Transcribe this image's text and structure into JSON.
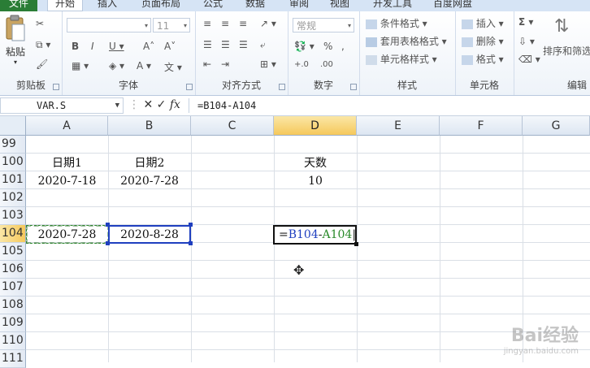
{
  "ribbon_tabs": [
    "文件",
    "开始",
    "插入",
    "页面布局",
    "公式",
    "数据",
    "审阅",
    "视图",
    "开发工具",
    "百度网盘"
  ],
  "groups": {
    "clipboard": {
      "label": "剪贴板",
      "paste": "粘贴"
    },
    "font": {
      "label": "字体",
      "size": "11"
    },
    "alignment": {
      "label": "对齐方式"
    },
    "number": {
      "label": "数字",
      "format": "常规"
    },
    "styles": {
      "label": "样式",
      "items": [
        "条件格式",
        "套用表格格式",
        "单元格样式"
      ]
    },
    "cells": {
      "label": "单元格",
      "items": [
        "插入",
        "删除",
        "格式"
      ]
    },
    "editing": {
      "label": "编辑",
      "sort": "排序和筛选"
    }
  },
  "formula_bar": {
    "name_box": "VAR.S",
    "formula": "=B104-A104"
  },
  "columns": [
    "A",
    "B",
    "C",
    "D",
    "E",
    "F",
    "G"
  ],
  "rows": [
    "99",
    "100",
    "101",
    "102",
    "103",
    "104",
    "105",
    "106",
    "107",
    "108",
    "109",
    "110",
    "111"
  ],
  "cells": {
    "A100": "日期1",
    "B100": "日期2",
    "D100": "天数",
    "A101": "2020-7-18",
    "B101": "2020-7-28",
    "D101": "10",
    "A104": "2020-7-28",
    "B104": "2020-8-28"
  },
  "edit": {
    "eq": "=",
    "refB": "B104",
    "minus": "-",
    "refA": "A104"
  },
  "colors": {
    "refB": "#1f3fbf",
    "refA": "#2a8a2a",
    "selected_header": "#f5c85b"
  },
  "watermark": {
    "brand": "Bai经验",
    "url": "jingyan.baidu.com"
  }
}
